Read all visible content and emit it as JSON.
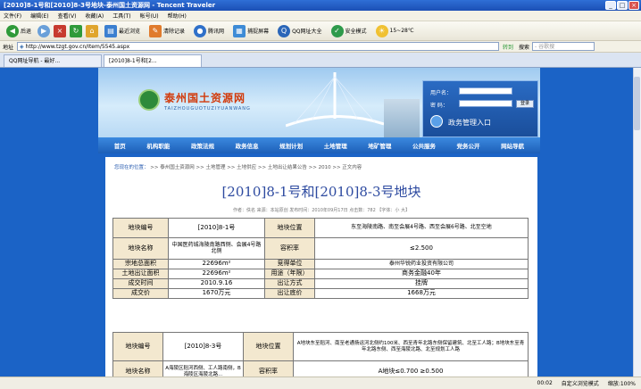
{
  "window": {
    "title": "[2010]8-1号和[2010]8-3号地块-泰州国土资源网 - Tencent Traveler"
  },
  "menu": [
    "文件(F)",
    "编辑(E)",
    "查看(V)",
    "收藏(A)",
    "工具(T)",
    "帐号(U)",
    "帮助(H)"
  ],
  "toolbar": {
    "back": "后退",
    "history": "最近浏览",
    "clear": "清除记录",
    "tencent": "腾讯网",
    "capture": "捕捉屏幕",
    "qq_browser": "QQ网址大全",
    "safe": "安全模式",
    "weather": "15~28℃"
  },
  "address": {
    "label": "地址",
    "url": "http://www.tzgt.gov.cn/Item/5545.aspx",
    "go": "转到",
    "search": "搜索",
    "search_placeholder": "- 谷歌搜"
  },
  "tabs": [
    "QQ网址导航 - 最好...",
    "[2010]8-1号和[2..."
  ],
  "site": {
    "name": "泰州国土资源网",
    "subname": "TAIZHOUGUOTUZIYUANWANG",
    "user_label": "用户名：",
    "pass_label": "密  码：",
    "login_btn": "登录",
    "portal": "政务管理入口",
    "nav": [
      "首页",
      "机构职能",
      "政策法规",
      "政务信息",
      "规划计划",
      "土地管理",
      "地矿管理",
      "公共服务",
      "党务公开",
      "网站导航"
    ]
  },
  "article": {
    "crumb_prefix": "您现在的位置：",
    "crumb": ">> 泰州国土资源网 >> 土地管理 >> 土地供应 >> 土地出让结果公告 >> 2010 >> 正文内容",
    "title": "[2010]8-1号和[2010]8-3号地块",
    "meta": "作者：佚名  来源：本站原创  发布时间：2010年09月17日  点击数：782 【字体：小 大】"
  },
  "table1": {
    "r1": [
      "地块编号",
      "[2010]8-1号",
      "地块位置",
      "东至海陵南路、南至会展4号路、西至会展6号路、北至空地"
    ],
    "r2": [
      "地块名称",
      "中国医药城海陵南路西侧、会展4号路北侧",
      "容积率",
      "≤2.500"
    ],
    "r3": [
      "宗地总面积",
      "22696m²",
      "竞得单位",
      "泰州华锐药业投资有限公司"
    ],
    "r4": [
      "土地出让面积",
      "22696m²",
      "用途（年限）",
      "商务金融40年"
    ],
    "r5": [
      "成交时间",
      "2010.9.16",
      "出让方式",
      "挂牌"
    ],
    "r6": [
      "成交价",
      "1670万元",
      "出让底价",
      "1668万元"
    ]
  },
  "table2": {
    "r1": [
      "地块编号",
      "[2010]8-3号",
      "地块位置",
      "A地块东至稻河、南至老通扬运河北侧约100米、西至青年北路东侧保留建筑、北至工人路；B地块东至青年北路东侧、西至海陵北路、北至规划工人路"
    ],
    "r2": [
      "地块名称",
      "A海陵区稻河西侧、工人路南侧，B海陵区海陵北路...",
      "容积率",
      "A地块≤0.700 ≥0.500"
    ]
  },
  "status": {
    "time": "00:02",
    "mode": "自定义浏览模式",
    "zoom": "缩放:100%"
  }
}
